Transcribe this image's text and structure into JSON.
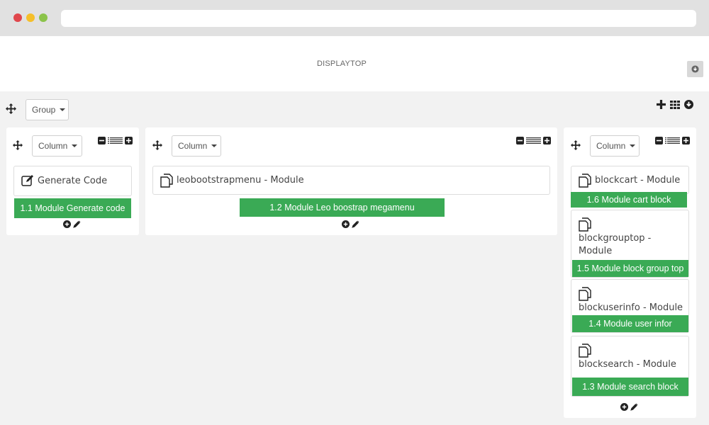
{
  "hook": {
    "title": "DISPLAYTOP"
  },
  "group": {
    "label": "Group"
  },
  "columns": [
    {
      "label": "Column",
      "modules": [
        {
          "name": "Generate Code",
          "tag": "1.1 Module Generate code"
        }
      ]
    },
    {
      "label": "Column",
      "modules": [
        {
          "name": "leobootstrapmenu - Module",
          "tag": "1.2 Module Leo boostrap megamenu"
        }
      ]
    },
    {
      "label": "Column",
      "modules": [
        {
          "name": "blockcart - Module",
          "tag": "1.6 Module cart block"
        },
        {
          "name_line1": "blockgrouptop -",
          "name_line2": "Module",
          "tag": "1.5 Module block group top"
        },
        {
          "name": "blockuserinfo - Module",
          "tag": "1.4 Module user infor"
        },
        {
          "name": "blocksearch - Module",
          "tag": "1.3 Module search block"
        }
      ]
    }
  ],
  "colors": {
    "accent_green": "#3aaa55",
    "background": "#f2f2f2",
    "chrome": "#e1e1e1"
  }
}
